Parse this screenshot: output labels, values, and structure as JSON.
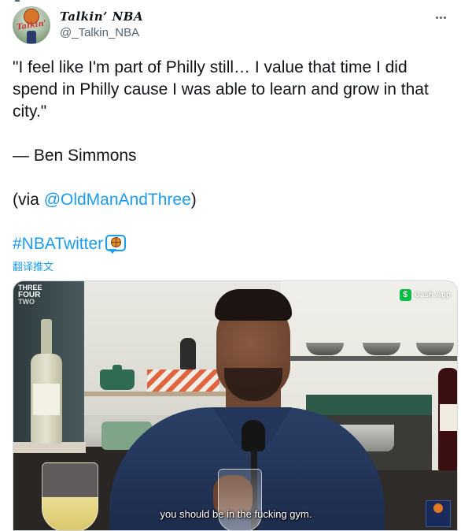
{
  "author": {
    "display_name": "Talkin’ NBA",
    "handle": "@_Talkin_NBA",
    "avatar_icon": "talkin-nba-logo",
    "avatar_text": "Talkin'"
  },
  "tweet": {
    "quote": "\"I feel like I'm part of Philly still… I value that time I did spend in Philly cause I was able to learn and grow in that city.\"",
    "attribution": "— Ben Simmons",
    "via_prefix": "(via ",
    "via_handle": "@OldManAndThree",
    "via_suffix": ")",
    "hashtag": "#NBATwitter",
    "hashtag_icon": "basketball-speech-bubble-icon",
    "translate_label": "翻译推文"
  },
  "media": {
    "brand_top_left": [
      "THREE",
      "FOUR",
      "TWO"
    ],
    "sponsor_label": "Cash App",
    "sponsor_icon": "$",
    "subtitle": "you should be in the fucking gym.",
    "badge_br": "Old Man & the Three"
  },
  "colors": {
    "link": "#1d9bf0",
    "text": "#0f1419",
    "muted": "#536471",
    "cashapp_green": "#00c244"
  }
}
